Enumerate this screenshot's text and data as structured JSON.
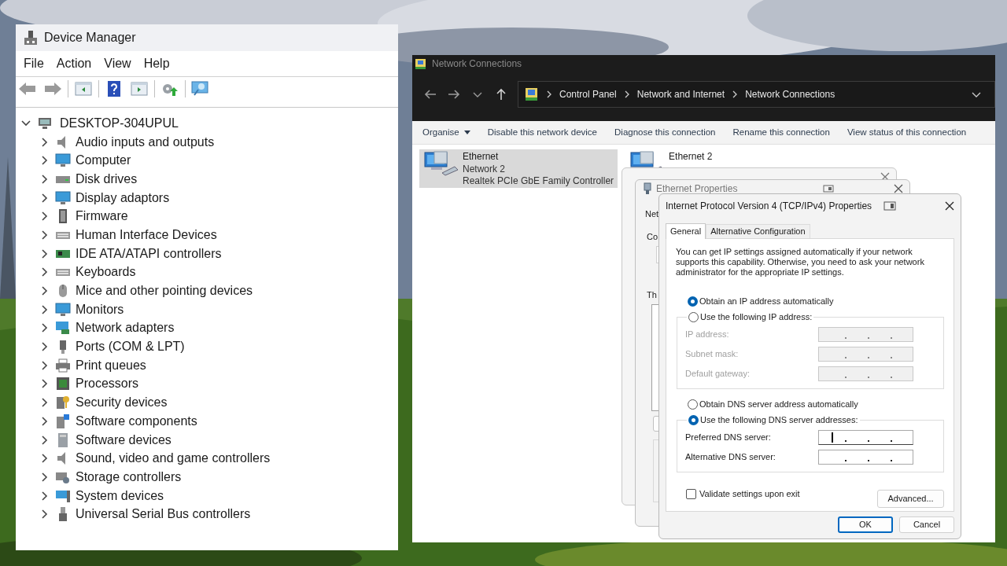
{
  "device_manager": {
    "title": "Device Manager",
    "menu": [
      "File",
      "Action",
      "View",
      "Help"
    ],
    "tree": {
      "label": "DESKTOP-304UPUL",
      "expanded": true,
      "children": [
        {
          "label": "Audio inputs and outputs",
          "expanded": false
        },
        {
          "label": "Computer",
          "expanded": false
        },
        {
          "label": "Disk drives",
          "expanded": false
        },
        {
          "label": "Display adaptors",
          "expanded": false
        },
        {
          "label": "Firmware",
          "expanded": false
        },
        {
          "label": "Human Interface Devices",
          "expanded": false
        },
        {
          "label": "IDE ATA/ATAPI controllers",
          "expanded": false
        },
        {
          "label": "Keyboards",
          "expanded": false
        },
        {
          "label": "Mice and other pointing devices",
          "expanded": false
        },
        {
          "label": "Monitors",
          "expanded": false
        },
        {
          "label": "Network adapters",
          "expanded": false
        },
        {
          "label": "Ports (COM & LPT)",
          "expanded": false
        },
        {
          "label": "Print queues",
          "expanded": false
        },
        {
          "label": "Processors",
          "expanded": false
        },
        {
          "label": "Security devices",
          "expanded": false
        },
        {
          "label": "Software components",
          "expanded": false
        },
        {
          "label": "Software devices",
          "expanded": false
        },
        {
          "label": "Sound, video and game controllers",
          "expanded": false
        },
        {
          "label": "Storage controllers",
          "expanded": false
        },
        {
          "label": "System devices",
          "expanded": false
        },
        {
          "label": "Universal Serial Bus controllers",
          "expanded": false
        }
      ]
    }
  },
  "network_connections": {
    "title": "Network Connections",
    "breadcrumb": [
      "Control Panel",
      "Network and Internet",
      "Network Connections"
    ],
    "commands": [
      {
        "label": "Organise",
        "kind": "menu"
      },
      {
        "label": "Disable this network device",
        "kind": "action"
      },
      {
        "label": "Diagnose this connection",
        "kind": "action"
      },
      {
        "label": "Rename this connection",
        "kind": "action"
      },
      {
        "label": "View status of this connection",
        "kind": "action"
      }
    ],
    "items": [
      {
        "name": "Ethernet",
        "lines": [
          "Network 2",
          "Realtek PCIe GbE Family Controller"
        ],
        "selected": true
      },
      {
        "name": "Ethernet 2",
        "selected": false
      }
    ]
  },
  "ethernet_properties": {
    "title": "Ethernet Properties",
    "fragments": [
      "Net",
      "Co",
      "Th"
    ]
  },
  "ipv4_dialog": {
    "title": "Internet Protocol Version 4 (TCP/IPv4) Properties",
    "tabs": [
      {
        "label": "General",
        "selected": true
      },
      {
        "label": "Alternative Configuration",
        "selected": false
      }
    ],
    "description": "You can get IP settings assigned automatically if your network supports this capability. Otherwise, you need to ask your network administrator for the appropriate IP settings.",
    "ip_options": [
      {
        "label": "Obtain an IP address automatically",
        "selected": true
      },
      {
        "label": "Use the following IP address:",
        "selected": false
      }
    ],
    "ip_fields": [
      {
        "label": "IP address:",
        "disabled": true,
        "focused": false
      },
      {
        "label": "Subnet mask:",
        "disabled": true,
        "focused": false
      },
      {
        "label": "Default gateway:",
        "disabled": true,
        "focused": false
      }
    ],
    "dns_options": [
      {
        "label": "Obtain DNS server address automatically",
        "selected": false
      },
      {
        "label": "Use the following DNS server addresses:",
        "selected": true
      }
    ],
    "dns_fields": [
      {
        "label": "Preferred DNS server:",
        "disabled": false,
        "focused": true
      },
      {
        "label": "Alternative DNS server:",
        "disabled": false,
        "focused": false
      }
    ],
    "validate": {
      "label": "Validate settings upon exit",
      "checked": false
    },
    "advanced_button": "Advanced...",
    "buttons": [
      {
        "label": "OK",
        "default": true
      },
      {
        "label": "Cancel",
        "default": false
      }
    ]
  }
}
